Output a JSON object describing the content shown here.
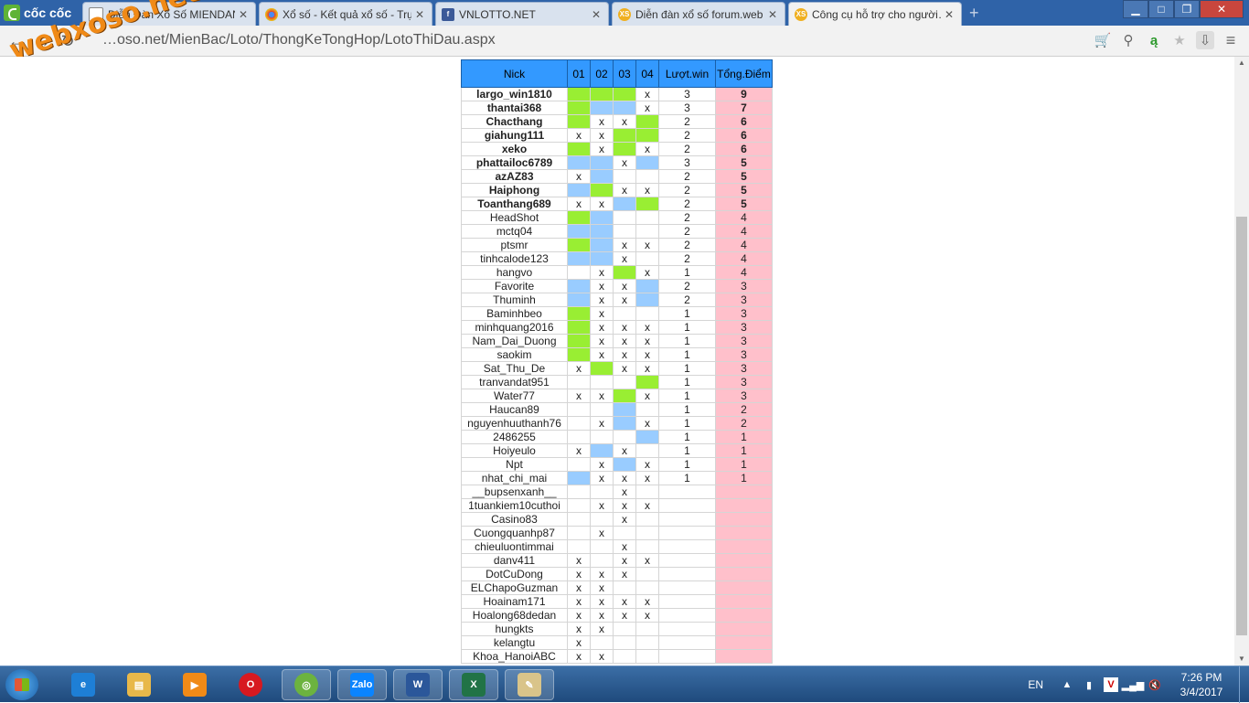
{
  "browser": {
    "brand": "cốc cốc",
    "tabs": [
      {
        "label": "Diễn Đàn Xổ Số MIENDAN…",
        "icon": "page-icon",
        "active": false
      },
      {
        "label": "Xổ số - Kết quả xổ số - Trực",
        "icon": "chrome-icon",
        "active": false
      },
      {
        "label": "VNLOTTO.NET",
        "icon": "facebook-icon",
        "active": false
      },
      {
        "label": "Diễn đàn xổ số forum.web…",
        "icon": "xs-icon",
        "active": false
      },
      {
        "label": "Công cụ hỗ trợ cho người…",
        "icon": "xs-icon",
        "active": true
      }
    ],
    "url": "…oso.net/MienBac/Loto/ThongKeTongHop/LotoThiDau.aspx",
    "watermark": "webxoso.net"
  },
  "table": {
    "headers": [
      "Nick",
      "01",
      "02",
      "03",
      "04",
      "Lượt.win",
      "Tổng.Điểm"
    ],
    "rows": [
      {
        "nick": "largo_win1810",
        "color": "red",
        "c": [
          "g",
          "g",
          "g",
          "x"
        ],
        "win": "3",
        "score": "9"
      },
      {
        "nick": "thantai368",
        "color": "orange",
        "c": [
          "g",
          "b",
          "b",
          "x"
        ],
        "win": "3",
        "score": "7"
      },
      {
        "nick": "Chacthang",
        "color": "blue",
        "c": [
          "g",
          "x",
          "x",
          "g"
        ],
        "win": "2",
        "score": "6"
      },
      {
        "nick": "giahung111",
        "color": "blue",
        "c": [
          "x",
          "x",
          "g",
          "g"
        ],
        "win": "2",
        "score": "6"
      },
      {
        "nick": "xeko",
        "color": "blue",
        "c": [
          "g",
          "x",
          "g",
          "x"
        ],
        "win": "2",
        "score": "6"
      },
      {
        "nick": "phattailoc6789",
        "color": "green",
        "c": [
          "b",
          "b",
          "x",
          "b"
        ],
        "win": "3",
        "score": "5"
      },
      {
        "nick": "azAZ83",
        "color": "green",
        "c": [
          "x",
          "b",
          "",
          ""
        ],
        "win": "2",
        "score": "5"
      },
      {
        "nick": "Haiphong",
        "color": "green",
        "c": [
          "b",
          "g",
          "x",
          "x"
        ],
        "win": "2",
        "score": "5"
      },
      {
        "nick": "Toanthang689",
        "color": "green",
        "c": [
          "x",
          "x",
          "b",
          "g"
        ],
        "win": "2",
        "score": "5"
      },
      {
        "nick": "HeadShot",
        "color": "",
        "c": [
          "g",
          "b",
          "",
          ""
        ],
        "win": "2",
        "score": "4"
      },
      {
        "nick": "mctq04",
        "color": "",
        "c": [
          "b",
          "b",
          "",
          ""
        ],
        "win": "2",
        "score": "4"
      },
      {
        "nick": "ptsmr",
        "color": "",
        "c": [
          "g",
          "b",
          "x",
          "x"
        ],
        "win": "2",
        "score": "4"
      },
      {
        "nick": "tinhcalode123",
        "color": "",
        "c": [
          "b",
          "b",
          "x",
          ""
        ],
        "win": "2",
        "score": "4"
      },
      {
        "nick": "hangvo",
        "color": "",
        "c": [
          "",
          "x",
          "g",
          "x"
        ],
        "win": "1",
        "score": "4"
      },
      {
        "nick": "Favorite",
        "color": "",
        "c": [
          "b",
          "x",
          "x",
          "b"
        ],
        "win": "2",
        "score": "3"
      },
      {
        "nick": "Thuminh",
        "color": "",
        "c": [
          "b",
          "x",
          "x",
          "b"
        ],
        "win": "2",
        "score": "3"
      },
      {
        "nick": "Baminhbeo",
        "color": "",
        "c": [
          "g",
          "x",
          "",
          ""
        ],
        "win": "1",
        "score": "3"
      },
      {
        "nick": "minhquang2016",
        "color": "",
        "c": [
          "g",
          "x",
          "x",
          "x"
        ],
        "win": "1",
        "score": "3"
      },
      {
        "nick": "Nam_Dai_Duong",
        "color": "",
        "c": [
          "g",
          "x",
          "x",
          "x"
        ],
        "win": "1",
        "score": "3"
      },
      {
        "nick": "saokim",
        "color": "",
        "c": [
          "g",
          "x",
          "x",
          "x"
        ],
        "win": "1",
        "score": "3"
      },
      {
        "nick": "Sat_Thu_De",
        "color": "",
        "c": [
          "x",
          "g",
          "x",
          "x"
        ],
        "win": "1",
        "score": "3"
      },
      {
        "nick": "tranvandat951",
        "color": "",
        "c": [
          "",
          "",
          "",
          "g"
        ],
        "win": "1",
        "score": "3"
      },
      {
        "nick": "Water77",
        "color": "",
        "c": [
          "x",
          "x",
          "g",
          "x"
        ],
        "win": "1",
        "score": "3"
      },
      {
        "nick": "Haucan89",
        "color": "",
        "c": [
          "",
          "",
          "b",
          ""
        ],
        "win": "1",
        "score": "2"
      },
      {
        "nick": "nguyenhuuthanh76",
        "color": "",
        "c": [
          "",
          "x",
          "b",
          "x"
        ],
        "win": "1",
        "score": "2"
      },
      {
        "nick": "2486255",
        "color": "",
        "c": [
          "",
          "",
          "",
          "b"
        ],
        "win": "1",
        "score": "1"
      },
      {
        "nick": "Hoiyeulo",
        "color": "",
        "c": [
          "x",
          "b",
          "x",
          ""
        ],
        "win": "1",
        "score": "1"
      },
      {
        "nick": "Npt",
        "color": "",
        "c": [
          "",
          "x",
          "b",
          "x"
        ],
        "win": "1",
        "score": "1"
      },
      {
        "nick": "nhat_chi_mai",
        "color": "",
        "c": [
          "b",
          "x",
          "x",
          "x"
        ],
        "win": "1",
        "score": "1"
      },
      {
        "nick": "__bupsenxanh__",
        "color": "",
        "c": [
          "",
          "",
          "x",
          ""
        ],
        "win": "",
        "score": ""
      },
      {
        "nick": "1tuankiem10cuthoi",
        "color": "",
        "c": [
          "",
          "x",
          "x",
          "x"
        ],
        "win": "",
        "score": ""
      },
      {
        "nick": "Casino83",
        "color": "",
        "c": [
          "",
          "",
          "x",
          ""
        ],
        "win": "",
        "score": ""
      },
      {
        "nick": "Cuongquanhp87",
        "color": "",
        "c": [
          "",
          "x",
          "",
          ""
        ],
        "win": "",
        "score": ""
      },
      {
        "nick": "chieuluontimmai",
        "color": "",
        "c": [
          "",
          "",
          "x",
          ""
        ],
        "win": "",
        "score": ""
      },
      {
        "nick": "danv411",
        "color": "",
        "c": [
          "x",
          "",
          "x",
          "x"
        ],
        "win": "",
        "score": ""
      },
      {
        "nick": "DotCuDong",
        "color": "",
        "c": [
          "x",
          "x",
          "x",
          ""
        ],
        "win": "",
        "score": ""
      },
      {
        "nick": "ELChapoGuzman",
        "color": "",
        "c": [
          "x",
          "x",
          "",
          ""
        ],
        "win": "",
        "score": ""
      },
      {
        "nick": "Hoainam171",
        "color": "",
        "c": [
          "x",
          "x",
          "x",
          "x"
        ],
        "win": "",
        "score": ""
      },
      {
        "nick": "Hoalong68dedan",
        "color": "",
        "c": [
          "x",
          "x",
          "x",
          "x"
        ],
        "win": "",
        "score": ""
      },
      {
        "nick": "hungkts",
        "color": "",
        "c": [
          "x",
          "x",
          "",
          ""
        ],
        "win": "",
        "score": ""
      },
      {
        "nick": "kelangtu",
        "color": "",
        "c": [
          "x",
          "",
          "",
          ""
        ],
        "win": "",
        "score": ""
      },
      {
        "nick": "Khoa_HanoiABC",
        "color": "",
        "c": [
          "x",
          "x",
          "",
          ""
        ],
        "win": "",
        "score": ""
      }
    ]
  },
  "taskbar": {
    "apps": [
      "ie-icon",
      "explorer-icon",
      "media-icon",
      "opera-icon",
      "coccoc-icon",
      "zalo-icon",
      "word-icon",
      "excel-icon",
      "paint-icon"
    ],
    "zalo_label": "Zalo",
    "lang": "EN",
    "time": "7:26 PM",
    "date": "3/4/2017"
  }
}
